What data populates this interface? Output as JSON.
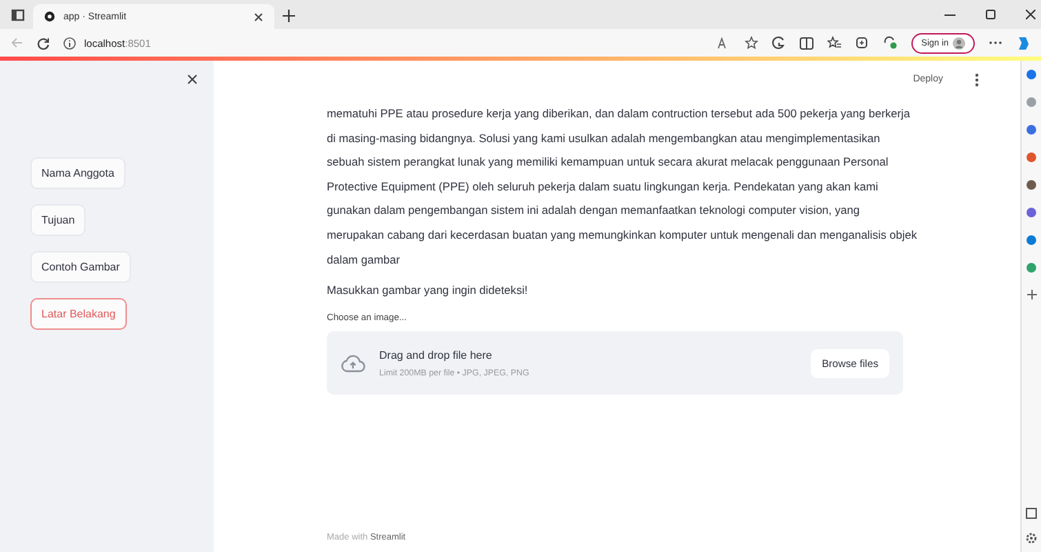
{
  "browser": {
    "tab_title": "app · Streamlit",
    "url_host": "localhost",
    "url_port": ":8501",
    "sign_in": "Sign in"
  },
  "sidebar": {
    "items": [
      {
        "label": "Nama Anggota",
        "selected": false
      },
      {
        "label": "Tujuan",
        "selected": false
      },
      {
        "label": "Contoh Gambar",
        "selected": false
      },
      {
        "label": "Latar Belakang",
        "selected": true
      }
    ]
  },
  "header": {
    "deploy": "Deploy"
  },
  "main": {
    "paragraph": "mematuhi PPE atau prosedure kerja yang diberikan, dan dalam contruction tersebut ada 500 pekerja yang berkerja di masing-masing bidangnya. Solusi yang kami usulkan adalah mengembangkan atau mengimplementasikan sebuah sistem perangkat lunak yang memiliki kemampuan untuk secara akurat melacak penggunaan Personal Protective Equipment (PPE) oleh seluruh pekerja dalam suatu lingkungan kerja. Pendekatan yang akan kami gunakan dalam pengembangan sistem ini adalah dengan memanfaatkan teknologi computer vision, yang merupakan cabang dari kecerdasan buatan yang memungkinkan komputer untuk mengenali dan menganalisis objek dalam gambar",
    "prompt": "Masukkan gambar yang ingin dideteksi!",
    "uploader": {
      "label": "Choose an image...",
      "title": "Drag and drop file here",
      "limit": "Limit 200MB per file • JPG, JPEG, PNG",
      "button": "Browse files"
    },
    "footer": "Made with **Streamlit**"
  }
}
